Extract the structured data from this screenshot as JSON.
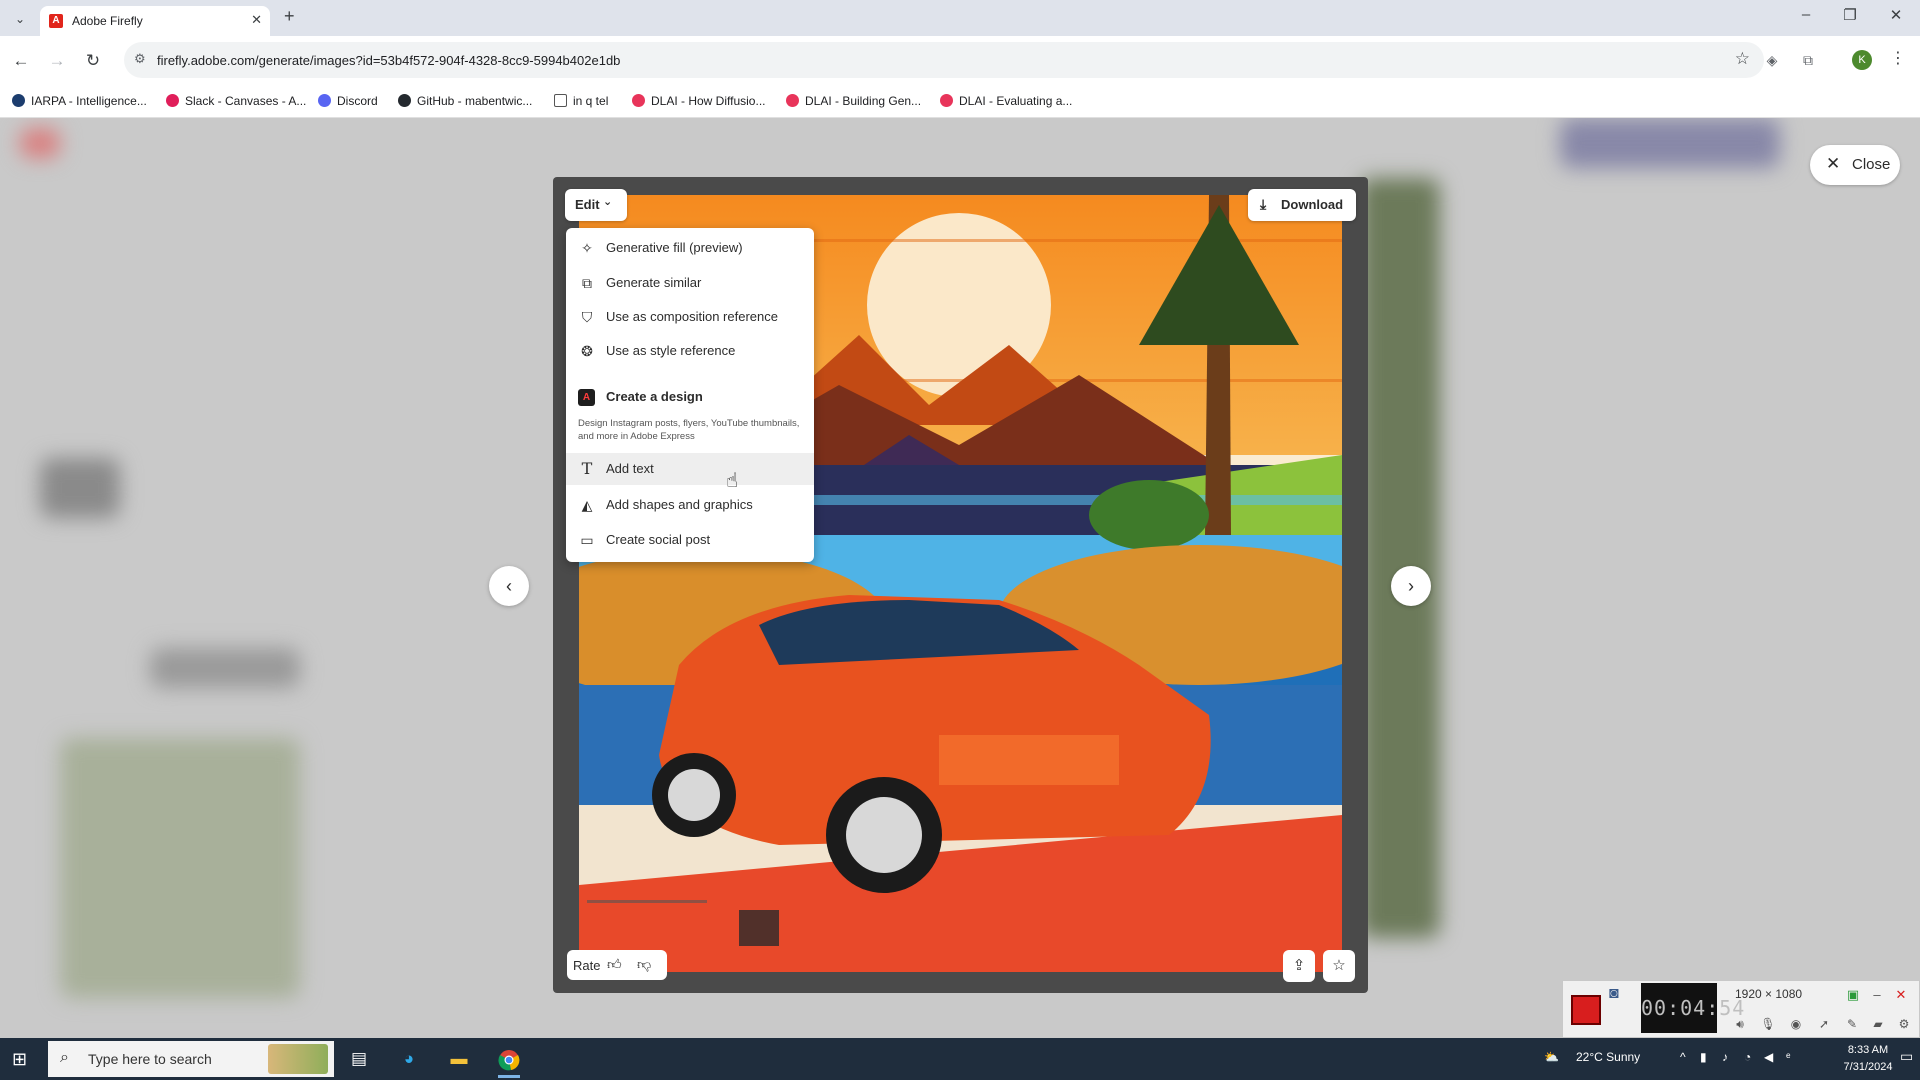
{
  "browser": {
    "tab_title": "Adobe Firefly",
    "tab_close": "✕",
    "new_tab": "+",
    "url": "firefly.adobe.com/generate/images?id=53b4f572-904f-4328-8cc9-5994b402e1db",
    "profile_initial": "K"
  },
  "bookmarks": [
    {
      "label": "IARPA - Intelligence...",
      "color": "#1c3d6e"
    },
    {
      "label": "Slack - Canvases - A...",
      "color": "#e01e5a"
    },
    {
      "label": "Discord",
      "color": "#5865f2"
    },
    {
      "label": "GitHub - mabentwic...",
      "color": "#24292e"
    },
    {
      "label": "in q tel",
      "color": "#ffffff"
    },
    {
      "label": "DLAI - How Diffusio...",
      "color": "#e8345a"
    },
    {
      "label": "DLAI - Building Gen...",
      "color": "#e8345a"
    },
    {
      "label": "DLAI - Evaluating a...",
      "color": "#e8345a"
    }
  ],
  "modal": {
    "close_label": "Close",
    "edit_label": "Edit",
    "download_label": "Download",
    "rate_label": "Rate"
  },
  "edit_menu": {
    "items": [
      {
        "label": "Generative fill (preview)",
        "icon": "generative-fill-icon"
      },
      {
        "label": "Generate similar",
        "icon": "generate-similar-icon"
      },
      {
        "label": "Use as composition reference",
        "icon": "composition-reference-icon"
      },
      {
        "label": "Use as style reference",
        "icon": "style-reference-icon"
      }
    ],
    "section_title": "Create a design",
    "section_description": "Design Instagram posts, flyers, YouTube thumbnails, and more in Adobe Express",
    "design_items": [
      {
        "label": "Add text",
        "icon": "text-icon",
        "hovered": true
      },
      {
        "label": "Add shapes and graphics",
        "icon": "shapes-icon"
      },
      {
        "label": "Create social post",
        "icon": "social-post-icon"
      }
    ]
  },
  "recorder": {
    "timer": "00:04:54",
    "resolution": "1920 × 1080"
  },
  "taskbar": {
    "search_placeholder": "Type here to search",
    "weather": "22°C  Sunny",
    "time": "8:33 AM",
    "date": "7/31/2024"
  },
  "colors": {
    "adobe_red": "#e1251b",
    "recorder_stop": "#d81e1e",
    "taskbar": "#1f2d3d"
  }
}
